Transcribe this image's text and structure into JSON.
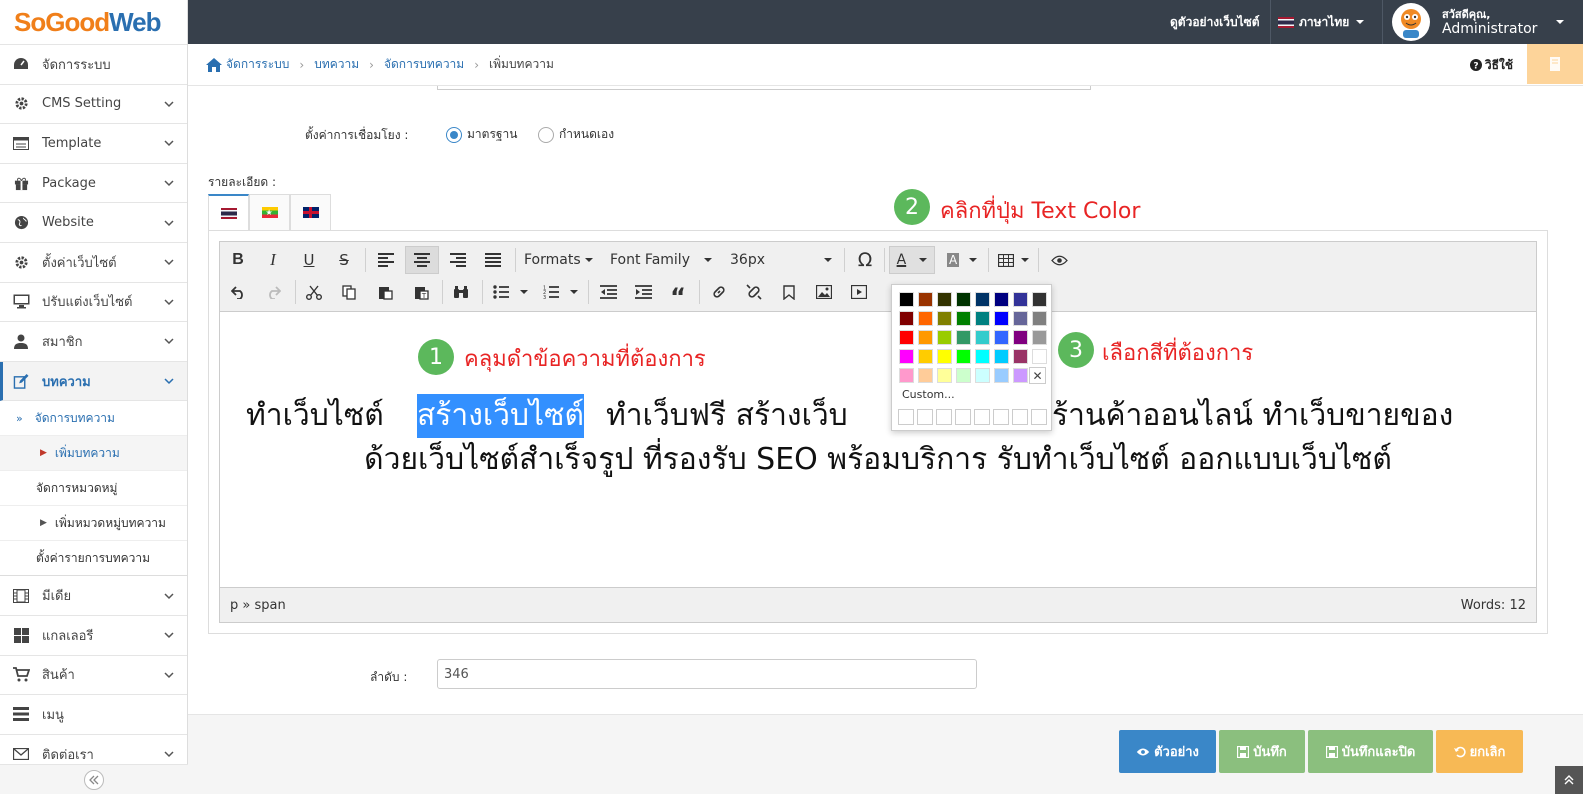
{
  "logo": {
    "part1": "SoGood",
    "part2": "Web",
    "color1": "#f07f1a",
    "color2": "#2a6fb0"
  },
  "topbar": {
    "preview_site": "ดูตัวอย่างเว็บไซต์",
    "language": "ภาษาไทย",
    "greeting": "สวัสดีคุณ,",
    "user": "Administrator"
  },
  "sidebar": {
    "items": [
      {
        "label": "จัดการระบบ",
        "icon": "dashboard-icon"
      },
      {
        "label": "CMS Setting",
        "icon": "gear-icon"
      },
      {
        "label": "Template",
        "icon": "template-icon"
      },
      {
        "label": "Package",
        "icon": "gift-icon"
      },
      {
        "label": "Website",
        "icon": "globe-icon"
      },
      {
        "label": "ตั้งค่าเว็บไซต์",
        "icon": "gear-icon"
      },
      {
        "label": "ปรับแต่งเว็บไซต์",
        "icon": "monitor-icon"
      },
      {
        "label": "สมาชิก",
        "icon": "user-icon"
      },
      {
        "label": "บทความ",
        "icon": "edit-icon"
      }
    ],
    "sub": [
      {
        "label": "จัดการบทความ"
      },
      {
        "label": "เพิ่มบทความ"
      },
      {
        "label": "จัดการหมวดหมู่"
      },
      {
        "label": "เพิ่มหมวดหมู่บทความ"
      },
      {
        "label": "ตั้งค่ารายการบทความ"
      }
    ],
    "items2": [
      {
        "label": "มีเดีย",
        "icon": "film-icon"
      },
      {
        "label": "แกลเลอรี",
        "icon": "grid-icon"
      },
      {
        "label": "สินค้า",
        "icon": "cart-icon"
      },
      {
        "label": "เมนู",
        "icon": "menu-icon"
      },
      {
        "label": "ติดต่อเรา",
        "icon": "envelope-icon"
      }
    ]
  },
  "breadcrumb": [
    "จัดการระบบ",
    "บทความ",
    "จัดการบทความ",
    "เพิ่มบทความ"
  ],
  "help": "วิธีใช้",
  "form": {
    "link_setting_label": "ตั้งค่าการเชื่อมโยง :",
    "radio_standard": "มาตรฐาน",
    "radio_custom": "กำหนดเอง",
    "detail_label": "รายละเอียด :",
    "order_label": "ลำดับ :",
    "order_value": "346"
  },
  "editor": {
    "formats": "Formats",
    "font_family": "Font Family",
    "font_size": "36px",
    "content_before": "ทำเว็บไซต์ ",
    "content_selected": "สร้างเว็บไซต์",
    "content_after": " ทำเว็บฟรี สร้างเว็บ",
    "content_right": "ร้านค้าออนไลน์ ทำเว็บขายของ",
    "content_line2": "ด้วยเว็บไซต์สำเร็จรูป ที่รองรับ SEO พร้อมบริการ รับทำเว็บไซต์ ออกแบบเว็บไซต์",
    "path": "p » span",
    "words": "Words: 12",
    "palette_custom": "Custom...",
    "palette_colors": [
      [
        "#000000",
        "#993300",
        "#333300",
        "#003300",
        "#003366",
        "#000080",
        "#333399",
        "#333333"
      ],
      [
        "#800000",
        "#ff6600",
        "#808000",
        "#008000",
        "#008080",
        "#0000ff",
        "#666699",
        "#808080"
      ],
      [
        "#ff0000",
        "#ff9900",
        "#99cc00",
        "#339966",
        "#33cccc",
        "#3366ff",
        "#800080",
        "#999999"
      ],
      [
        "#ff00ff",
        "#ffcc00",
        "#ffff00",
        "#00ff00",
        "#00ffff",
        "#00ccff",
        "#993366",
        "#ffffff"
      ],
      [
        "#ff99cc",
        "#ffcc99",
        "#ffff99",
        "#ccffcc",
        "#ccffff",
        "#99ccff",
        "#cc99ff",
        ""
      ]
    ]
  },
  "annotations": [
    {
      "num": "1",
      "text": "คลุมดำข้อความที่ต้องการ"
    },
    {
      "num": "2",
      "text": "คลิกที่ปุ่ม Text Color"
    },
    {
      "num": "3",
      "text": "เลือกสีที่ต้องการ"
    }
  ],
  "buttons": {
    "preview": "ตัวอย่าง",
    "save": "บันทึก",
    "save_close": "บันทึกและปิด",
    "cancel": "ยกเลิก"
  },
  "colors": {
    "primary": "#3a87c8",
    "success": "#8bbf7e",
    "warning": "#f7b955",
    "topbar": "#37404b",
    "annotation": "#e82424"
  }
}
